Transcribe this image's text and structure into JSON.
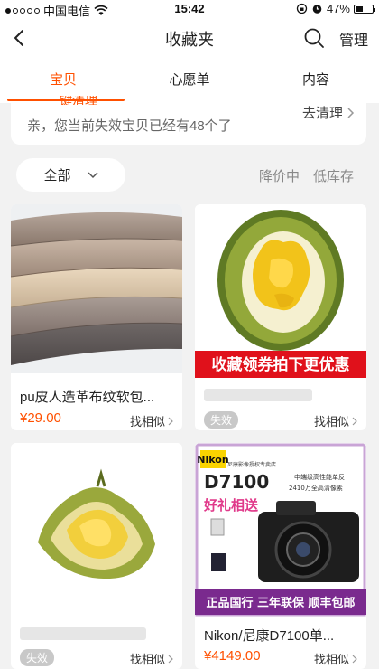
{
  "status_bar": {
    "carrier": "中国电信",
    "time": "15:42",
    "battery": "47%",
    "battery_level": 0.47
  },
  "navbar": {
    "title": "收藏夹",
    "manage_label": "管理"
  },
  "tabs": [
    {
      "label": "宝贝",
      "active": true
    },
    {
      "label": "心愿单",
      "active": false
    },
    {
      "label": "内容",
      "active": false
    }
  ],
  "notice": {
    "cut_text": "一键清理",
    "text": "亲，您当前失效宝贝已经有48个了",
    "action_label": "去清理"
  },
  "filters": {
    "select_value": "全部",
    "options": [
      "降价中",
      "低库存"
    ]
  },
  "products": [
    {
      "title": "pu皮人造革布纹软包...",
      "price": "¥29.00",
      "similar_label": "找相似",
      "invalid": false,
      "image": "pu-leather-rolls-image"
    },
    {
      "title": "",
      "price": "",
      "similar_label": "找相似",
      "invalid": true,
      "invalid_label": "失效",
      "image": "durian-promo-image",
      "banner": "收藏领券拍下更优惠"
    },
    {
      "title": "",
      "price": "",
      "similar_label": "找相似",
      "invalid": true,
      "invalid_label": "失效",
      "image": "durian-image"
    },
    {
      "title": "Nikon/尼康D7100单...",
      "price": "¥4149.00",
      "similar_label": "找相似",
      "invalid": false,
      "image": "nikon-d7100-image",
      "poster": {
        "brand": "Nikon",
        "brand_sub": "尼康影像授权专卖店",
        "model": "D7100",
        "tagline1": "中端级高性能单反",
        "tagline2": "2410万全高清像素",
        "gift": "好礼相送",
        "footer": "正品国行  三年联保  顺丰包邮"
      }
    }
  ],
  "colors": {
    "accent": "#ff5000",
    "background": "#f2f2f2"
  }
}
